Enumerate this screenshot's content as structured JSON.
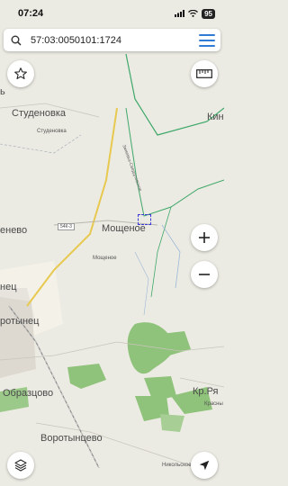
{
  "status_bar": {
    "time": "07:24",
    "battery": "95"
  },
  "search": {
    "query": "57:03:0050101:1724"
  },
  "map_labels": {
    "studenovka_big": "Студеновка",
    "studenovka_small": "Студеновка",
    "mosсhenoe_big": "Мощеное",
    "moshchenoe_small": "Мощеное",
    "road_code": "54К-3",
    "road_side": "Змиевка-Свердловское",
    "enovo": "енево",
    "nets": "нец",
    "orotynets": "ротынец",
    "obraztsovo": "Образцово",
    "vorotyntsevo": "Воротынцево",
    "kr_rya": "Кр.Ря",
    "krasny": "Красны",
    "nikolskoe": "Никольское",
    "kin": "Кин",
    "left_v": "ь"
  },
  "icons": {
    "search": "search-icon",
    "menu": "menu-icon",
    "favorite": "star-icon",
    "ruler": "ruler-icon",
    "zoom_in": "plus-icon",
    "zoom_out": "minus-icon",
    "layers": "layers-icon",
    "locate": "location-arrow-icon"
  },
  "colors": {
    "accent": "#2f7bd6",
    "forest": "#8fc27a",
    "road_main": "#e7c94f",
    "road_green": "#3fa86a"
  }
}
